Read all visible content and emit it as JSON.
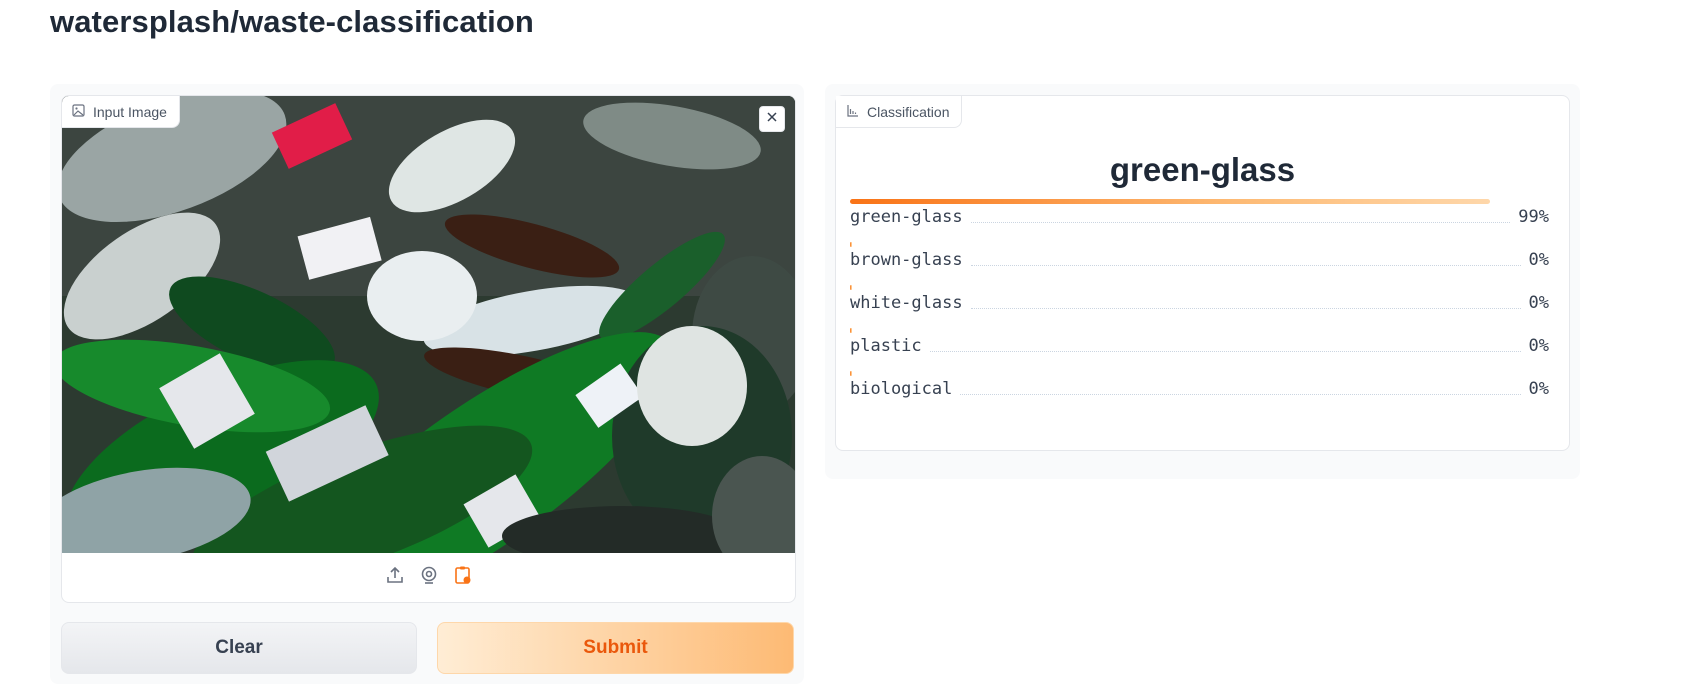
{
  "page": {
    "title": "watersplash/waste-classification"
  },
  "input": {
    "label": "Input Image",
    "label_icon": "image-icon",
    "clear_icon": "close-icon",
    "sources": [
      {
        "name": "upload",
        "icon": "upload-icon"
      },
      {
        "name": "webcam",
        "icon": "webcam-icon"
      },
      {
        "name": "clipboard",
        "icon": "clipboard-icon",
        "active": true
      }
    ]
  },
  "buttons": {
    "clear": "Clear",
    "submit": "Submit"
  },
  "output": {
    "label": "Classification",
    "label_icon": "bar-chart-icon",
    "top_class": "green-glass",
    "confidences": [
      {
        "label": "green-glass",
        "value_text": "99%",
        "value": 0.99
      },
      {
        "label": "brown-glass",
        "value_text": "0%",
        "value": 0.0
      },
      {
        "label": "white-glass",
        "value_text": "0%",
        "value": 0.0
      },
      {
        "label": "plastic",
        "value_text": "0%",
        "value": 0.0
      },
      {
        "label": "biological",
        "value_text": "0%",
        "value": 0.0
      }
    ]
  },
  "colors": {
    "accent": "#f97316",
    "accent_light": "#fdba74",
    "submit_text": "#ea580c"
  }
}
